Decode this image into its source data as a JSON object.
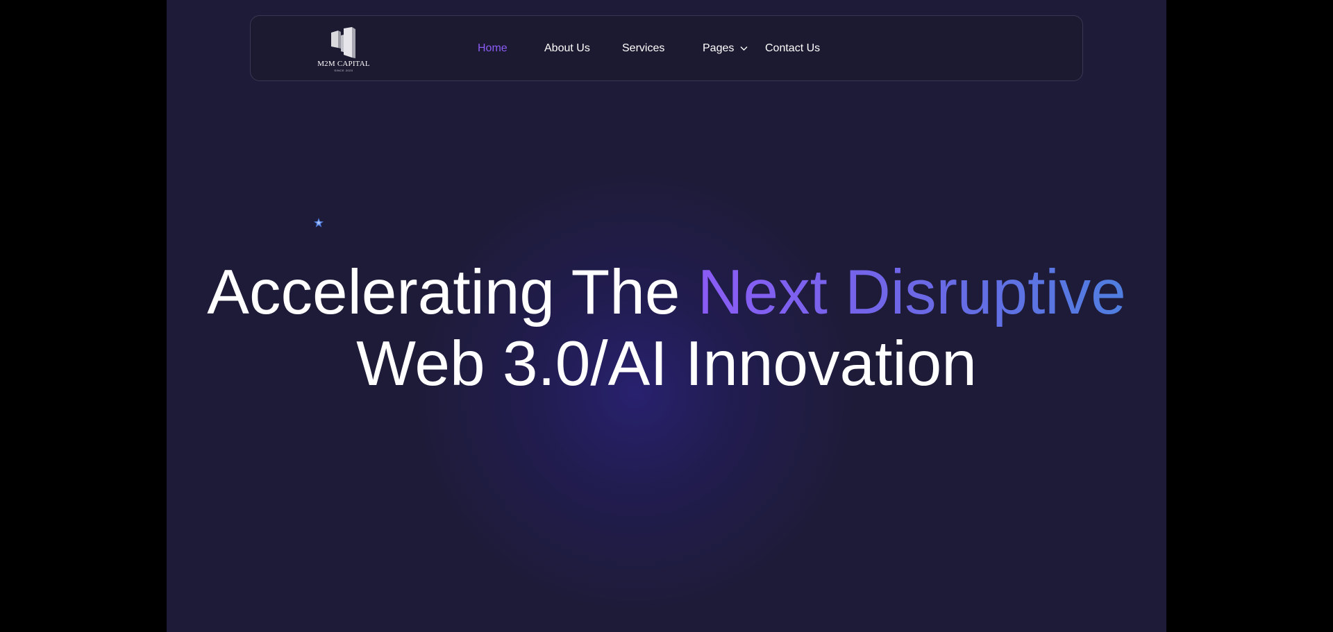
{
  "brand": {
    "name": "M2M CAPITAL",
    "tagline": "SINCE 2020"
  },
  "nav": {
    "items": [
      {
        "label": "Home",
        "active": true
      },
      {
        "label": "About Us",
        "active": false
      },
      {
        "label": "Services",
        "active": false
      },
      {
        "label": "Pages",
        "active": false,
        "has_dropdown": true
      },
      {
        "label": "Contact Us",
        "active": false
      }
    ]
  },
  "hero": {
    "line1_plain": "Accelerating The ",
    "line1_highlight": "Next Disruptive",
    "line2": "Web 3.0/AI Innovation"
  },
  "colors": {
    "background": "#1e1b38",
    "accent": "#8b5cf6",
    "gradient_end": "#4f7ee0",
    "text": "#ffffff"
  }
}
